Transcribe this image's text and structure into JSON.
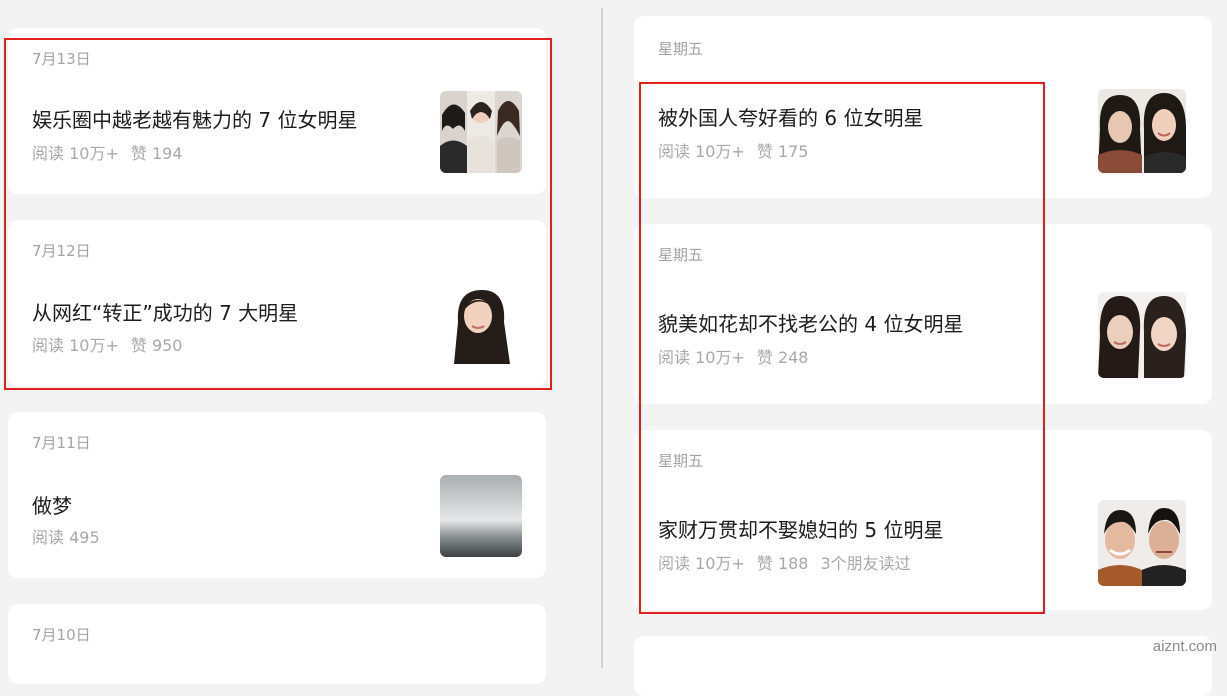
{
  "left_column": [
    {
      "date": "7月13日",
      "title": "娱乐圈中越老越有魅力的 7 位女明星",
      "reads": "阅读 10万+",
      "likes": "赞 194",
      "thumb": "three-actresses-photo"
    },
    {
      "date": "7月12日",
      "title": "从网红“转正”成功的 7 大明星",
      "reads": "阅读 10万+",
      "likes": "赞 950",
      "thumb": "actress-portrait-photo"
    },
    {
      "date": "7月11日",
      "title": "做梦",
      "reads": "阅读 495",
      "likes": "",
      "thumb": "misty-gray-photo"
    },
    {
      "date": "7月10日",
      "title": "",
      "reads": "",
      "likes": ""
    }
  ],
  "right_column": [
    {
      "date": "星期五",
      "title": "被外国人夸好看的 6 位女明星",
      "reads": "阅读 10万+",
      "likes": "赞 175",
      "friends": "",
      "thumb": "two-actresses-photo"
    },
    {
      "date": "星期五",
      "title": "貌美如花却不找老公的 4 位女明星",
      "reads": "阅读 10万+",
      "likes": "赞 248",
      "friends": "",
      "thumb": "two-actresses-photo"
    },
    {
      "date": "星期五",
      "title": "家财万贯却不娶媳妇的 5 位明星",
      "reads": "阅读 10万+",
      "likes": "赞 188",
      "friends": "3个朋友读过",
      "thumb": "two-actors-photo"
    }
  ],
  "watermark": "aiznt.com",
  "colors": {
    "highlight": "#e0201e",
    "card": "#ffffff",
    "background": "#f3f3f3"
  }
}
